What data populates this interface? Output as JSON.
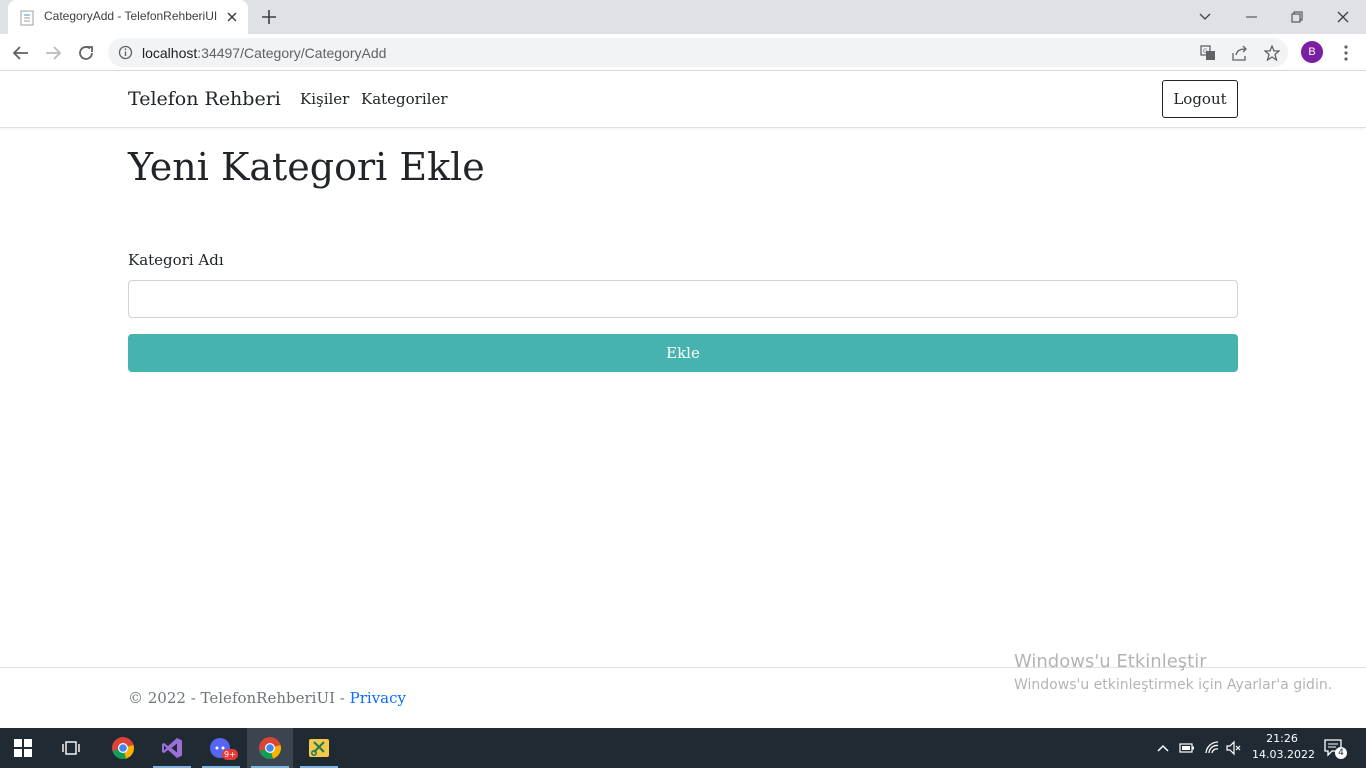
{
  "browser": {
    "tab_title": "CategoryAdd - TelefonRehberiUI",
    "url_host": "localhost",
    "url_path": ":34497/Category/CategoryAdd",
    "profile_initial": "B",
    "profile_color": "#7b1fa2"
  },
  "navbar": {
    "brand": "Telefon Rehberi",
    "links": [
      "Kişiler",
      "Kategoriler"
    ],
    "logout_label": "Logout"
  },
  "main": {
    "title": "Yeni Kategori Ekle",
    "field_label": "Kategori Adı",
    "field_value": "",
    "submit_label": "Ekle",
    "submit_color": "#46b3af"
  },
  "footer": {
    "text": "© 2022 - TelefonRehberiUI - ",
    "link": "Privacy"
  },
  "watermark": {
    "title": "Windows'u Etkinleştir",
    "subtitle": "Windows'u etkinleştirmek için Ayarlar'a gidin."
  },
  "taskbar": {
    "time": "21:26",
    "date": "14.03.2022",
    "notification_count": "4",
    "discord_badge": "9+"
  }
}
